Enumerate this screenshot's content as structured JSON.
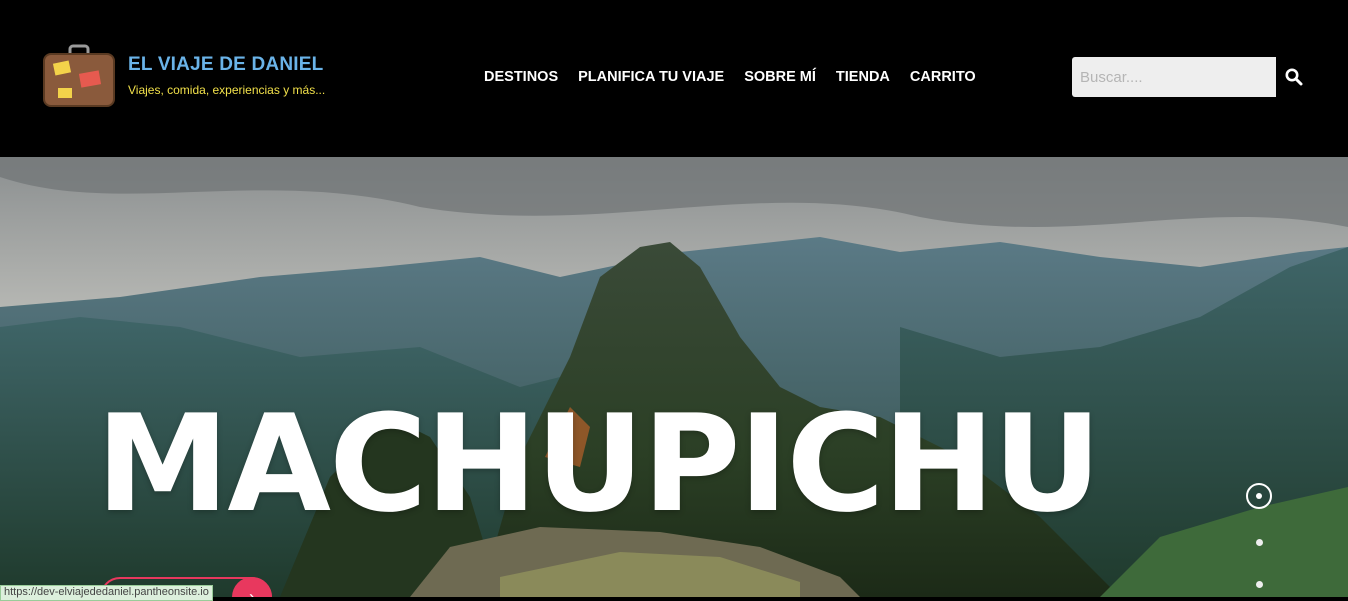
{
  "brand": {
    "title": "EL VIAJE DE DANIEL",
    "subtitle": "Viajes, comida, experiencias y más..."
  },
  "nav": {
    "items": [
      {
        "label": "DESTINOS"
      },
      {
        "label": "PLANIFICA TU VIAJE"
      },
      {
        "label": "SOBRE MÍ"
      },
      {
        "label": "TIENDA"
      },
      {
        "label": "CARRITO"
      }
    ]
  },
  "search": {
    "placeholder": "Buscar....",
    "icon": "search-icon"
  },
  "hero": {
    "title": "MACHUPICHU",
    "slider": {
      "current": 1,
      "total": 3
    }
  },
  "status_bar": {
    "url": "https://dev-elviajededaniel.pantheonsite.io"
  },
  "colors": {
    "header_bg": "#000000",
    "brand_title": "#6ab3e8",
    "brand_subtitle": "#f1e04a",
    "accent": "#e8385e"
  }
}
